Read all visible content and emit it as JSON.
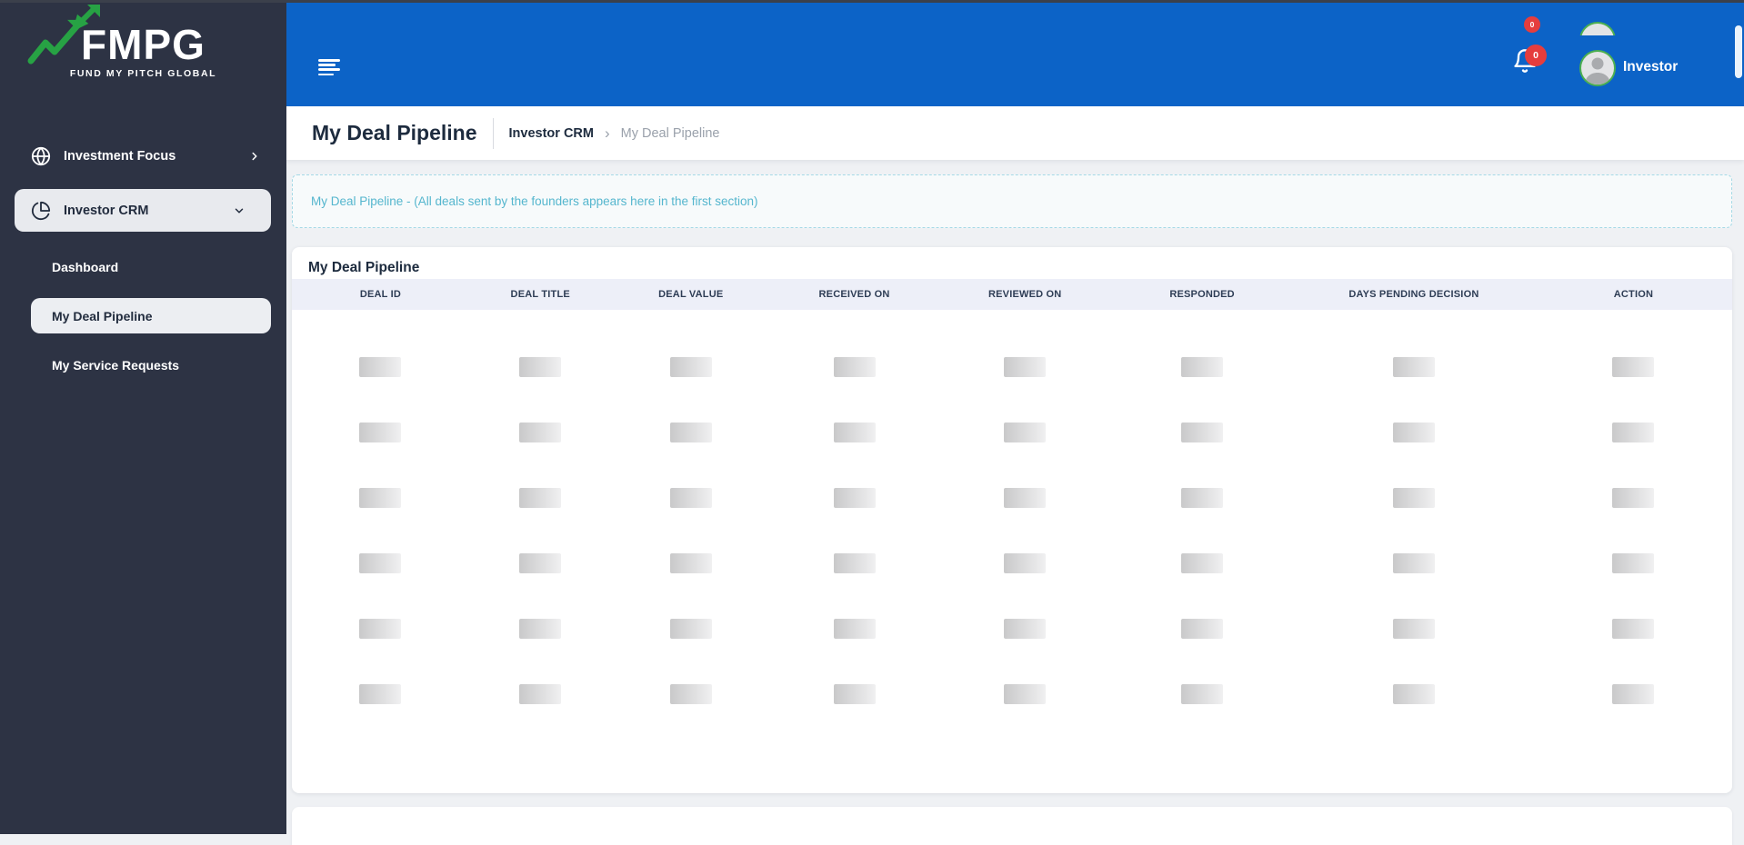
{
  "brand": {
    "logo_text": "FMPG",
    "tagline": "FUND MY PITCH GLOBAL",
    "logo_green": "#27a244"
  },
  "sidebar": {
    "items": [
      {
        "label": "Investment Focus",
        "icon": "globe-icon",
        "chevron": "right"
      },
      {
        "label": "Investor CRM",
        "icon": "pie-chart-icon",
        "chevron": "down"
      }
    ],
    "sub_items": [
      {
        "label": "Dashboard"
      },
      {
        "label": "My Deal Pipeline"
      },
      {
        "label": "My Service Requests"
      }
    ]
  },
  "header": {
    "notification_count": "0",
    "user_name": "Investor",
    "accent_blue": "#0c63c7",
    "badge_red": "#e53d3d",
    "avatar_ring_green": "#4caf50"
  },
  "breadcrumb": {
    "page_title": "My Deal Pipeline",
    "parent": "Investor CRM",
    "separator": "›",
    "current": "My Deal Pipeline"
  },
  "banner": {
    "text": "My Deal Pipeline - (All deals sent by the founders appears here in the first section)",
    "text_color": "#55b6ce"
  },
  "table": {
    "section_title": "My Deal Pipeline",
    "columns": [
      "DEAL ID",
      "DEAL TITLE",
      "DEAL VALUE",
      "RECEIVED ON",
      "REVIEWED ON",
      "RESPONDED",
      "DAYS PENDING DECISION",
      "ACTION"
    ],
    "skeleton_rows": 6
  }
}
